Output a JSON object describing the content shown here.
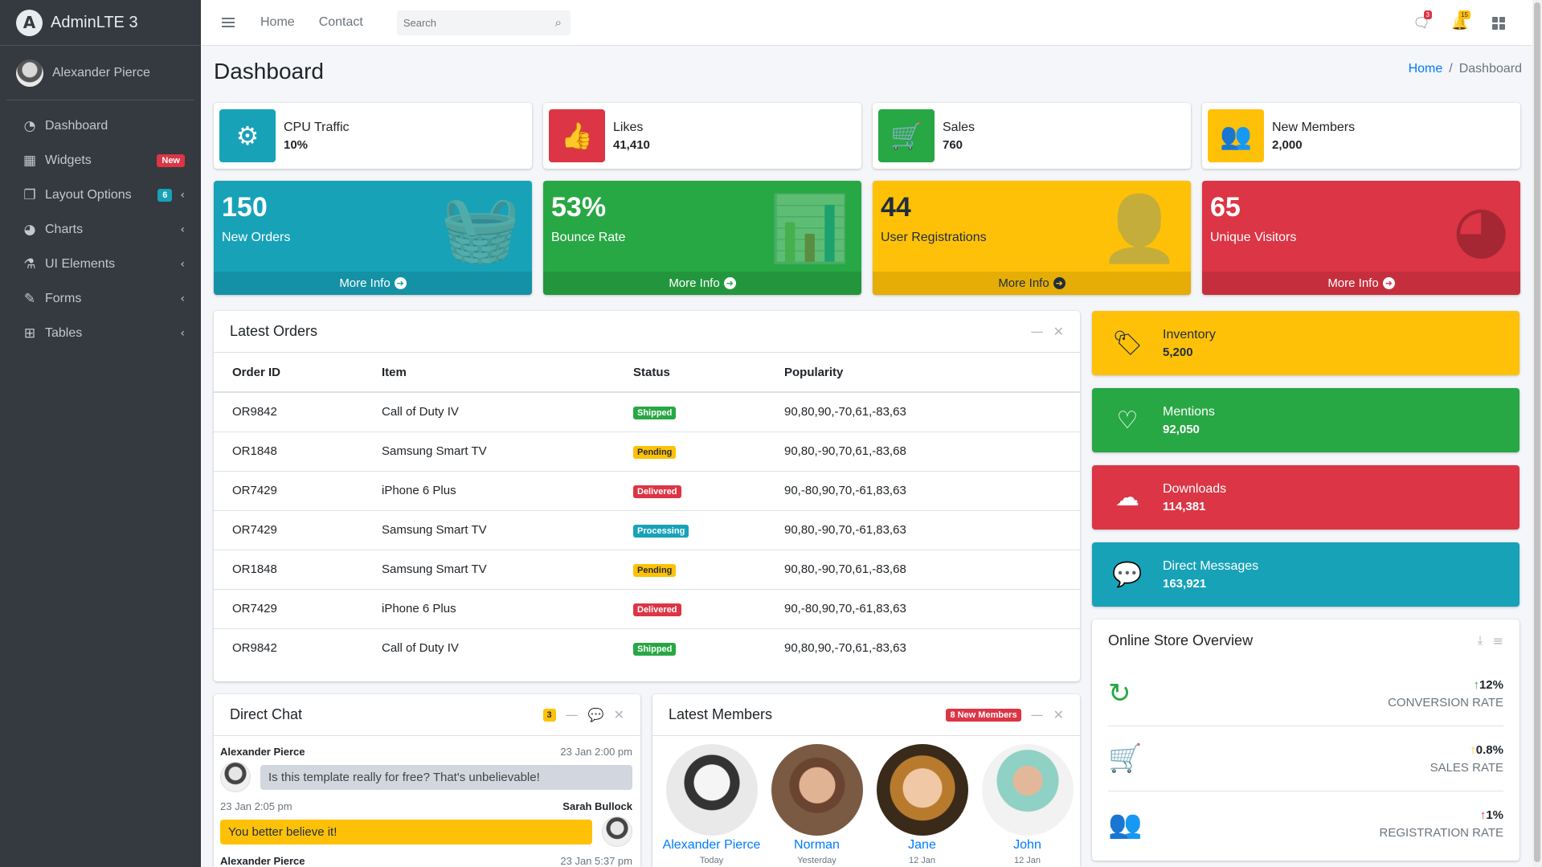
{
  "brand": {
    "name": "AdminLTE 3",
    "logo": "A"
  },
  "user": {
    "name": "Alexander Pierce"
  },
  "sidebar": {
    "items": [
      {
        "label": "Dashboard",
        "icon": "◔",
        "badge": "",
        "arrow": false
      },
      {
        "label": "Widgets",
        "icon": "▦",
        "badge": "New",
        "arrow": false
      },
      {
        "label": "Layout Options",
        "icon": "❐",
        "badge": "6",
        "arrow": true
      },
      {
        "label": "Charts",
        "icon": "◕",
        "badge": "",
        "arrow": true
      },
      {
        "label": "UI Elements",
        "icon": "⚗",
        "badge": "",
        "arrow": true
      },
      {
        "label": "Forms",
        "icon": "✎",
        "badge": "",
        "arrow": true
      },
      {
        "label": "Tables",
        "icon": "⊞",
        "badge": "",
        "arrow": true
      }
    ]
  },
  "navbar": {
    "links": [
      "Home",
      "Contact"
    ],
    "search_placeholder": "Search",
    "messages_count": "3",
    "notifications_count": "15"
  },
  "header": {
    "title": "Dashboard",
    "breadcrumb": {
      "home": "Home",
      "current": "Dashboard"
    }
  },
  "info_boxes": [
    {
      "label": "CPU Traffic",
      "value": "10%",
      "icon": "⚙",
      "color": "#17a2b8"
    },
    {
      "label": "Likes",
      "value": "41,410",
      "icon": "👍",
      "color": "#dc3545"
    },
    {
      "label": "Sales",
      "value": "760",
      "icon": "🛒",
      "color": "#28a745"
    },
    {
      "label": "New Members",
      "value": "2,000",
      "icon": "👥",
      "color": "#ffc107"
    }
  ],
  "small_boxes": [
    {
      "value": "150",
      "label": "New Orders",
      "footer": "More Info",
      "icon": "🧺",
      "color": "#17a2b8",
      "text": "#ffffff"
    },
    {
      "value": "53%",
      "label": "Bounce Rate",
      "footer": "More Info",
      "icon": "📊",
      "color": "#28a745",
      "text": "#ffffff"
    },
    {
      "value": "44",
      "label": "User Registrations",
      "footer": "More Info",
      "icon": "👤",
      "color": "#ffc107",
      "text": "#1f2d3d"
    },
    {
      "value": "65",
      "label": "Unique Visitors",
      "footer": "More Info",
      "icon": "◕",
      "color": "#dc3545",
      "text": "#ffffff"
    }
  ],
  "latest_orders": {
    "title": "Latest Orders",
    "columns": [
      "Order ID",
      "Item",
      "Status",
      "Popularity"
    ],
    "rows": [
      {
        "id": "OR9842",
        "item": "Call of Duty IV",
        "status": "Shipped",
        "status_type": "success",
        "popularity": "90,80,90,-70,61,-83,63"
      },
      {
        "id": "OR1848",
        "item": "Samsung Smart TV",
        "status": "Pending",
        "status_type": "warning",
        "popularity": "90,80,-90,70,61,-83,68"
      },
      {
        "id": "OR7429",
        "item": "iPhone 6 Plus",
        "status": "Delivered",
        "status_type": "danger",
        "popularity": "90,-80,90,70,-61,83,63"
      },
      {
        "id": "OR7429",
        "item": "Samsung Smart TV",
        "status": "Processing",
        "status_type": "info",
        "popularity": "90,80,-90,70,-61,83,63"
      },
      {
        "id": "OR1848",
        "item": "Samsung Smart TV",
        "status": "Pending",
        "status_type": "warning",
        "popularity": "90,80,-90,70,61,-83,68"
      },
      {
        "id": "OR7429",
        "item": "iPhone 6 Plus",
        "status": "Delivered",
        "status_type": "danger",
        "popularity": "90,-80,90,70,-61,83,63"
      },
      {
        "id": "OR9842",
        "item": "Call of Duty IV",
        "status": "Shipped",
        "status_type": "success",
        "popularity": "90,80,90,-70,61,-83,63"
      }
    ]
  },
  "right_boxes": [
    {
      "label": "Inventory",
      "value": "5,200",
      "icon": "🏷",
      "color": "#ffc107",
      "text": "#1f2d3d"
    },
    {
      "label": "Mentions",
      "value": "92,050",
      "icon": "♡",
      "color": "#28a745",
      "text": "#ffffff"
    },
    {
      "label": "Downloads",
      "value": "114,381",
      "icon": "☁",
      "color": "#dc3545",
      "text": "#ffffff"
    },
    {
      "label": "Direct Messages",
      "value": "163,921",
      "icon": "💬",
      "color": "#17a2b8",
      "text": "#ffffff"
    }
  ],
  "store_overview": {
    "title": "Online Store Overview",
    "stats": [
      {
        "value": "12%",
        "label": "CONVERSION RATE",
        "icon": "↻",
        "color": "#28a745",
        "trend_color": "#28a745"
      },
      {
        "value": "0.8%",
        "label": "SALES RATE",
        "icon": "🛒",
        "color": "#ffc107",
        "trend_color": "#ffc107"
      },
      {
        "value": "1%",
        "label": "REGISTRATION RATE",
        "icon": "👥",
        "color": "#dc3545",
        "trend_color": "#dc3545"
      }
    ]
  },
  "direct_chat": {
    "title": "Direct Chat",
    "badge": "3",
    "messages": [
      {
        "name": "Alexander Pierce",
        "time": "23 Jan 2:00 pm",
        "text": "Is this template really for free? That's unbelievable!",
        "side": "left"
      },
      {
        "name": "Sarah Bullock",
        "time": "23 Jan 2:05 pm",
        "text": "You better believe it!",
        "side": "right"
      },
      {
        "name": "Alexander Pierce",
        "time": "23 Jan 5:37 pm"
      }
    ]
  },
  "latest_members": {
    "title": "Latest Members",
    "badge": "8 New Members",
    "members": [
      {
        "name": "Alexander Pierce",
        "date": "Today"
      },
      {
        "name": "Norman",
        "date": "Yesterday"
      },
      {
        "name": "Jane",
        "date": "12 Jan"
      },
      {
        "name": "John",
        "date": "12 Jan"
      }
    ]
  }
}
